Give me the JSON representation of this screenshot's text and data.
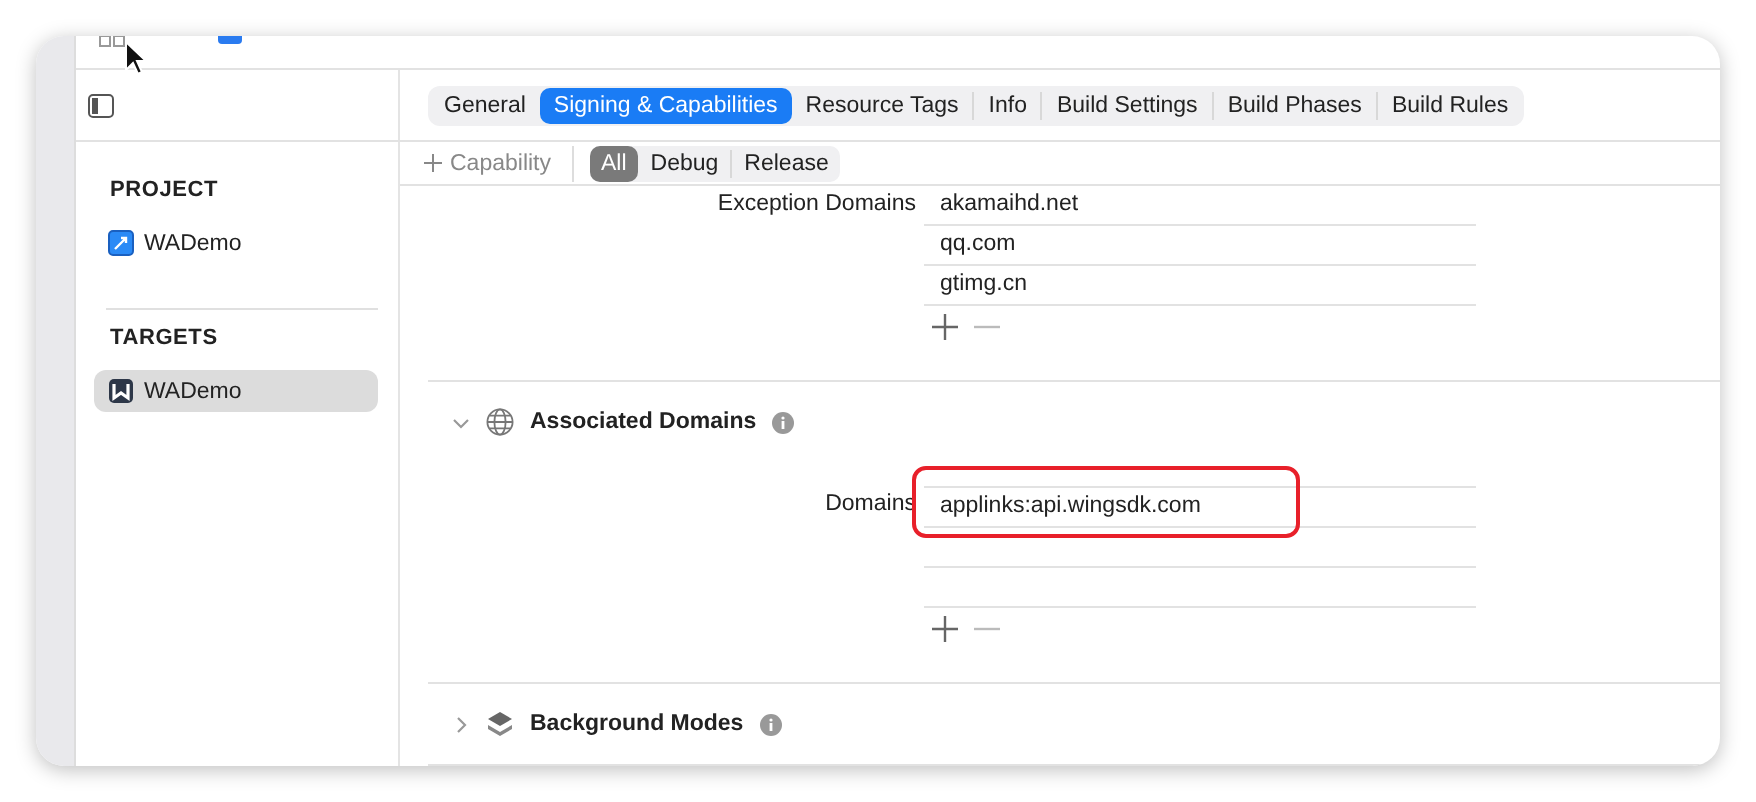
{
  "tabs": [
    {
      "label": "General",
      "selected": false
    },
    {
      "label": "Signing & Capabilities",
      "selected": true
    },
    {
      "label": "Resource Tags",
      "selected": false
    },
    {
      "label": "Info",
      "selected": false
    },
    {
      "label": "Build Settings",
      "selected": false
    },
    {
      "label": "Build Phases",
      "selected": false
    },
    {
      "label": "Build Rules",
      "selected": false
    }
  ],
  "filter_bar": {
    "add_capability": "Capability",
    "configs": [
      {
        "label": "All",
        "selected": true
      },
      {
        "label": "Debug",
        "selected": false
      },
      {
        "label": "Release",
        "selected": false
      }
    ]
  },
  "sidebar": {
    "sections": [
      {
        "heading": "PROJECT",
        "items": [
          {
            "label": "WADemo",
            "kind": "project",
            "selected": false
          }
        ]
      },
      {
        "heading": "TARGETS",
        "items": [
          {
            "label": "WADemo",
            "kind": "target",
            "selected": true
          }
        ]
      }
    ]
  },
  "exception_domains": {
    "label": "Exception Domains",
    "values": [
      "akamaihd.net",
      "qq.com",
      "gtimg.cn"
    ]
  },
  "capabilities": [
    {
      "title": "Associated Domains",
      "kind": "globe",
      "expanded": true,
      "field": {
        "label": "Domains",
        "values": [
          "applinks:api.wingsdk.com"
        ],
        "highlighted": true
      }
    },
    {
      "title": "Background Modes",
      "kind": "layers",
      "expanded": false
    }
  ]
}
